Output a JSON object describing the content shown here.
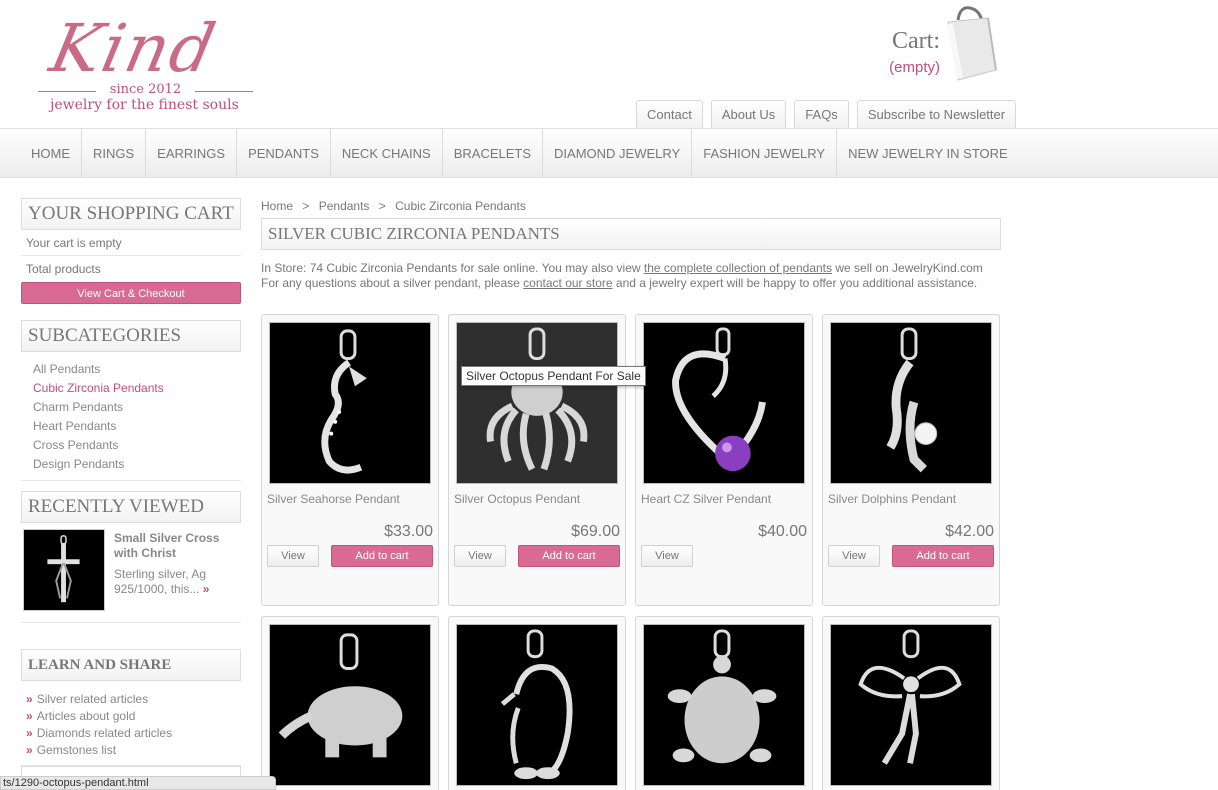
{
  "brand": {
    "logo_word": "Kind",
    "since": "since 2012",
    "tagline": "jewelry for the finest souls"
  },
  "cart_header": {
    "label": "Cart:",
    "status": "(empty)"
  },
  "top_links": [
    "Contact",
    "About Us",
    "FAQs",
    "Subscribe to Newsletter"
  ],
  "nav": [
    "HOME",
    "RINGS",
    "EARRINGS",
    "PENDANTS",
    "NECK CHAINS",
    "BRACELETS",
    "DIAMOND JEWELRY",
    "FASHION JEWELRY",
    "NEW JEWELRY IN STORE"
  ],
  "sidebar": {
    "cart": {
      "title": "YOUR SHOPPING CART",
      "empty_text": "Your cart is empty",
      "total_label": "Total products",
      "checkout_label": "View Cart & Checkout"
    },
    "subcategories": {
      "title": "SUBCATEGORIES",
      "items": [
        "All Pendants",
        "Cubic Zirconia Pendants",
        "Charm Pendants",
        "Heart Pendants",
        "Cross Pendants",
        "Design Pendants"
      ],
      "active_index": 1
    },
    "recently_viewed": {
      "title": "RECENTLY VIEWED",
      "item_name": "Small Silver Cross with Christ",
      "item_desc": "Sterling silver, Ag 925/1000, this...",
      "more_icon": "double-chevron-right-icon"
    },
    "learn": {
      "title": "LEARN AND SHARE",
      "items": [
        "Silver related articles",
        "Articles about gold",
        "Diamonds related articles",
        "Gemstones list"
      ]
    }
  },
  "breadcrumb": [
    "Home",
    "Pendants",
    "Cubic Zirconia Pendants"
  ],
  "breadcrumb_sep": ">",
  "category_title": "SILVER CUBIC ZIRCONIA PENDANTS",
  "intro": {
    "line1_a": "In Store: 74 Cubic Zirconia Pendants for sale online. You may also view ",
    "line1_link": "the complete collection of pendants",
    "line1_b": " we sell on JewelryKind.com",
    "line2_a": "For any questions about a silver pendant, please ",
    "line2_link": "contact our store",
    "line2_b": " and a jewelry expert will be happy to offer you additional assistance."
  },
  "products": [
    {
      "name": "Silver Seahorse Pendant",
      "price": "$33.00",
      "image": "seahorse-pendant-image"
    },
    {
      "name": "Silver Octopus Pendant",
      "price": "$69.00",
      "image": "octopus-pendant-image"
    },
    {
      "name": "Heart CZ Silver Pendant",
      "price": "$40.00",
      "image": "heart-pendant-image"
    },
    {
      "name": "Silver Dolphins Pendant",
      "price": "$42.00",
      "image": "dolphins-pendant-image"
    }
  ],
  "products_row2_images": [
    "elephant-pendant-image",
    "penguin-pendant-image",
    "turtle-pendant-image",
    "angel-pendant-image"
  ],
  "buttons": {
    "view": "View",
    "add": "Add to cart"
  },
  "tooltip": "Silver Octopus Pendant For Sale",
  "status_url": "ts/1290-octopus-pendant.html",
  "colors": {
    "accent": "#d96b93",
    "accent_text": "#c24f7a",
    "text": "#777777"
  }
}
